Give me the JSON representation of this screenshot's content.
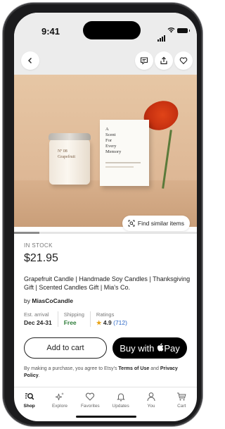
{
  "status_bar": {
    "time": "9:41"
  },
  "product": {
    "jar_label_number": "Nº 08",
    "jar_label_name": "Grapefruit",
    "box_text": "A\nScent\nFor\nEvery\nMemory",
    "find_similar_label": "Find similar items",
    "image_progress": 0.14,
    "stock": "IN STOCK",
    "price": "$21.95",
    "title": "Grapefruit Candle | Handmade Soy Candles | Thanksgiving Gift | Scented Candles Gift | Mia's Co.",
    "shop_prefix": "by",
    "shop_name": "MiasCoCandle"
  },
  "info": {
    "arrival_label": "Est. arrival",
    "arrival_value": "Dec 24-31",
    "shipping_label": "Shipping",
    "shipping_value": "Free",
    "ratings_label": "Ratings",
    "rating_value": "4.9",
    "rating_count": "(712)"
  },
  "actions": {
    "add_to_cart": "Add to cart",
    "buy_with": "Buy with",
    "pay": "Pay"
  },
  "legal": {
    "prefix": "By making a purchase, you agree to Etsy's",
    "terms": "Terms of Use",
    "and": "and",
    "privacy": "Privacy Policy",
    "suffix": "."
  },
  "tabs": [
    {
      "label": "Shop",
      "icon": "shop-search-icon"
    },
    {
      "label": "Explore",
      "icon": "sparkles-icon"
    },
    {
      "label": "Favorites",
      "icon": "heart-icon"
    },
    {
      "label": "Updates",
      "icon": "bell-icon"
    },
    {
      "label": "You",
      "icon": "person-icon"
    },
    {
      "label": "Cart",
      "icon": "cart-icon"
    }
  ],
  "colors": {
    "accent_green": "#2f7d3a",
    "rating_star": "#e8a317",
    "link_blue": "#2a66c7"
  }
}
